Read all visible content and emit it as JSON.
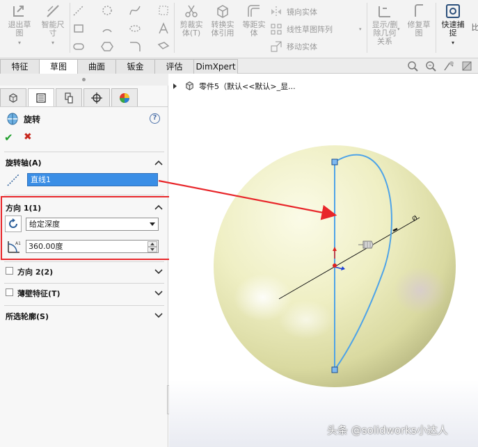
{
  "ribbon": {
    "buttons": [
      {
        "label": "退出草\n图",
        "icon": "exit-sketch-icon"
      },
      {
        "label": "智能尺\n寸",
        "icon": "smart-dimension-icon"
      },
      {
        "label": "剪裁实\n体(T)",
        "icon": "trim-entities-icon"
      },
      {
        "label": "转换实\n体引用",
        "icon": "convert-entities-icon"
      },
      {
        "label": "等距实\n体",
        "icon": "offset-entities-icon"
      },
      {
        "label": "显示/删\n除几何\n关系",
        "icon": "display-delete-relations-icon"
      },
      {
        "label": "修复草\n图",
        "icon": "repair-sketch-icon"
      },
      {
        "label": "快速捕\n捉",
        "icon": "quick-snaps-icon"
      }
    ],
    "rows": [
      "镜向实体",
      "线性草图阵列",
      "移动实体"
    ],
    "overflow_label": "比"
  },
  "tabs": [
    "特征",
    "草图",
    "曲面",
    "钣金",
    "评估",
    "DimXpert"
  ],
  "active_tab": "草图",
  "feature_tree": {
    "part_label": "零件5（默认<<默认>_显..."
  },
  "property_manager": {
    "title": "旋转",
    "help": "?",
    "ok": "✔",
    "cancel": "✖",
    "axis_section": {
      "title": "旋转轴(A)",
      "selection": "直线1"
    },
    "direction1": {
      "title": "方向 1(1)",
      "end_condition": "给定深度",
      "angle": "360.00度"
    },
    "direction2": {
      "title": "方向 2(2)",
      "checked": false
    },
    "thin_feature": {
      "title": "薄壁特征(T)",
      "checked": false
    },
    "selected_contours": {
      "title": "所选轮廓(S)"
    }
  },
  "watermark": "头条 @solidworks小达人",
  "colors": {
    "highlight_frame": "#e8262a",
    "selection_fill": "#3a8ee6",
    "sketch_line": "#4da3e8",
    "sphere": "#efefc4"
  }
}
